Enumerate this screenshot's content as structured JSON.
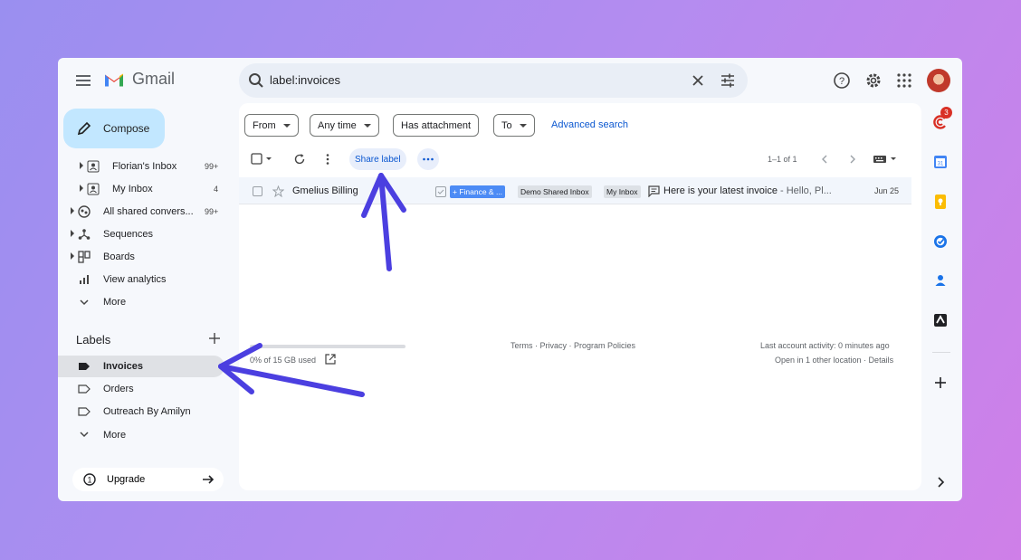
{
  "app": {
    "name": "Gmail"
  },
  "search": {
    "query": "label:invoices"
  },
  "compose_label": "Compose",
  "nav": [
    {
      "label": "Florian's Inbox",
      "count": "99+"
    },
    {
      "label": "My Inbox",
      "count": "4"
    },
    {
      "label": "All shared convers...",
      "count": "99+"
    },
    {
      "label": "Sequences",
      "count": ""
    },
    {
      "label": "Boards",
      "count": ""
    },
    {
      "label": "View analytics",
      "count": ""
    },
    {
      "label": "More",
      "count": ""
    }
  ],
  "labels_section": {
    "title": "Labels",
    "items": [
      {
        "label": "Invoices",
        "selected": true
      },
      {
        "label": "Orders",
        "selected": false
      },
      {
        "label": "Outreach By Amilyn",
        "selected": false
      },
      {
        "label": "More",
        "selected": false
      }
    ]
  },
  "upgrade_label": "Upgrade",
  "filters": {
    "from": "From",
    "any_time": "Any time",
    "has_attachment": "Has attachment",
    "to": "To",
    "advanced": "Advanced search"
  },
  "toolbar": {
    "share_label": "Share label",
    "pager": "1–1 of 1"
  },
  "email": {
    "sender": "Gmelius Billing",
    "tags": [
      "+ Finance & ...",
      "Demo Shared Inbox",
      "My Inbox"
    ],
    "subject": "Here is your latest invoice",
    "snippet": " - Hello, Pl...",
    "date": "Jun 25"
  },
  "footer": {
    "storage": "0% of 15 GB used",
    "links": "Terms · Privacy · Program Policies",
    "activity": "Last account activity: 0 minutes ago",
    "details": "Open in 1 other location · Details"
  },
  "right_panel": {
    "badge": "3"
  },
  "colors": {
    "accent": "#0b57d0",
    "compose_bg": "#c2e7ff",
    "arrow": "#4b3fe0",
    "tag_blue": "#4c8bf5"
  }
}
